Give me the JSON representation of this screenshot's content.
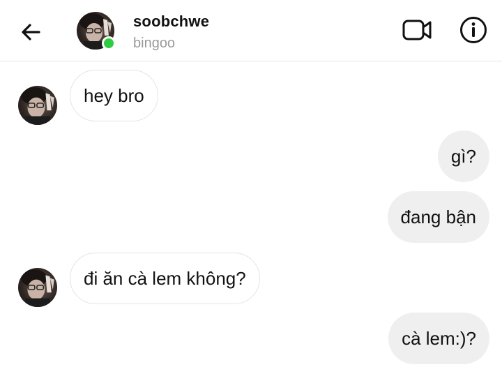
{
  "header": {
    "name": "soobchwe",
    "subtitle": "bingoo",
    "back_icon": "arrow-left-icon",
    "video_icon": "video-camera-icon",
    "info_icon": "info-icon",
    "online_color": "#2ecc40"
  },
  "messages": [
    {
      "direction": "incoming",
      "text": "hey bro"
    },
    {
      "direction": "outgoing",
      "text": "gì?"
    },
    {
      "direction": "outgoing",
      "text": "đang bận"
    },
    {
      "direction": "incoming",
      "text": "đi ăn cà lem không?"
    },
    {
      "direction": "outgoing",
      "text": "cà lem:)?"
    }
  ],
  "colors": {
    "incoming_bubble": "#ffffff",
    "outgoing_bubble": "#efefef",
    "text": "#111111",
    "subtitle": "#9a9a9a"
  }
}
